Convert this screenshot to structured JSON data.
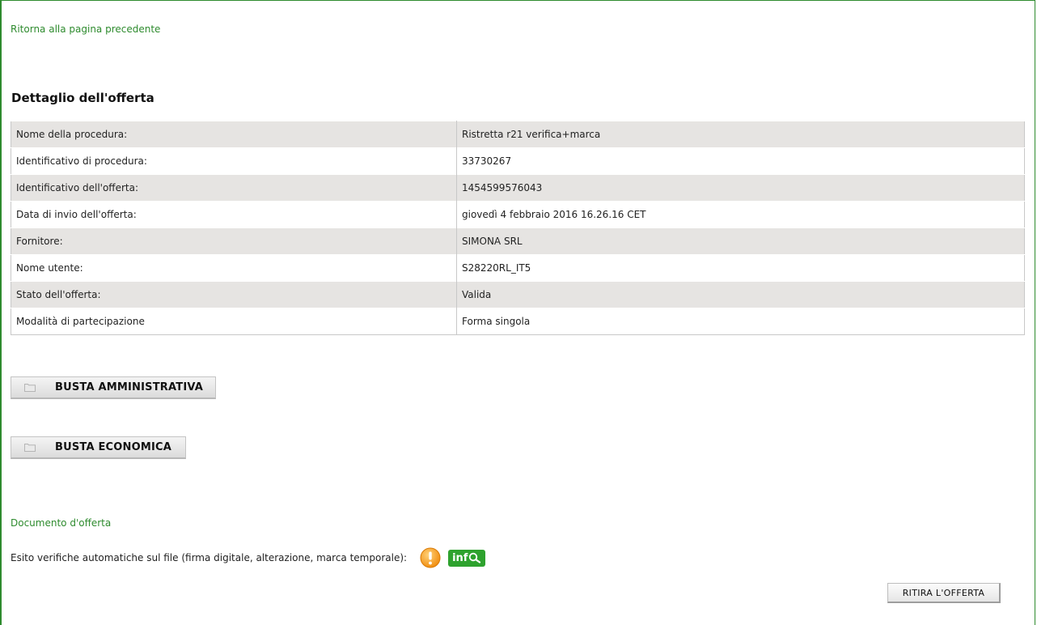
{
  "nav": {
    "back_link": "Ritorna alla pagina precedente"
  },
  "page": {
    "title": "Dettaglio dell'offerta"
  },
  "details": {
    "rows": [
      {
        "label": "Nome della procedura:",
        "value": "Ristretta r21 verifica+marca"
      },
      {
        "label": "Identificativo di procedura:",
        "value": "33730267"
      },
      {
        "label": "Identificativo dell'offerta:",
        "value": "1454599576043"
      },
      {
        "label": "Data di invio dell'offerta:",
        "value": "giovedì 4 febbraio 2016 16.26.16 CET"
      },
      {
        "label": "Fornitore:",
        "value": "SIMONA SRL"
      },
      {
        "label": "Nome utente:",
        "value": "S28220RL_IT5"
      },
      {
        "label": "Stato dell'offerta:",
        "value": "Valida"
      },
      {
        "label": "Modalità di partecipazione",
        "value": "Forma singola"
      }
    ]
  },
  "envelopes": {
    "amministrativa": "BUSTA AMMINISTRATIVA",
    "economica": "BUSTA ECONOMICA"
  },
  "document": {
    "label": "Documento d'offerta",
    "checks_text": "Esito verifiche automatiche sul file (firma digitale, alterazione, marca temporale):",
    "warning_icon": "warning-icon",
    "info_icon_text": "inf",
    "info_icon": "info-magnifier-icon"
  },
  "actions": {
    "withdraw": "RITIRA L'OFFERTA"
  },
  "colors": {
    "accent_green": "#2e8b2e",
    "row_shade": "#e6e4e2",
    "warning_orange": "#f5a01a",
    "info_green": "#2ea22e"
  }
}
